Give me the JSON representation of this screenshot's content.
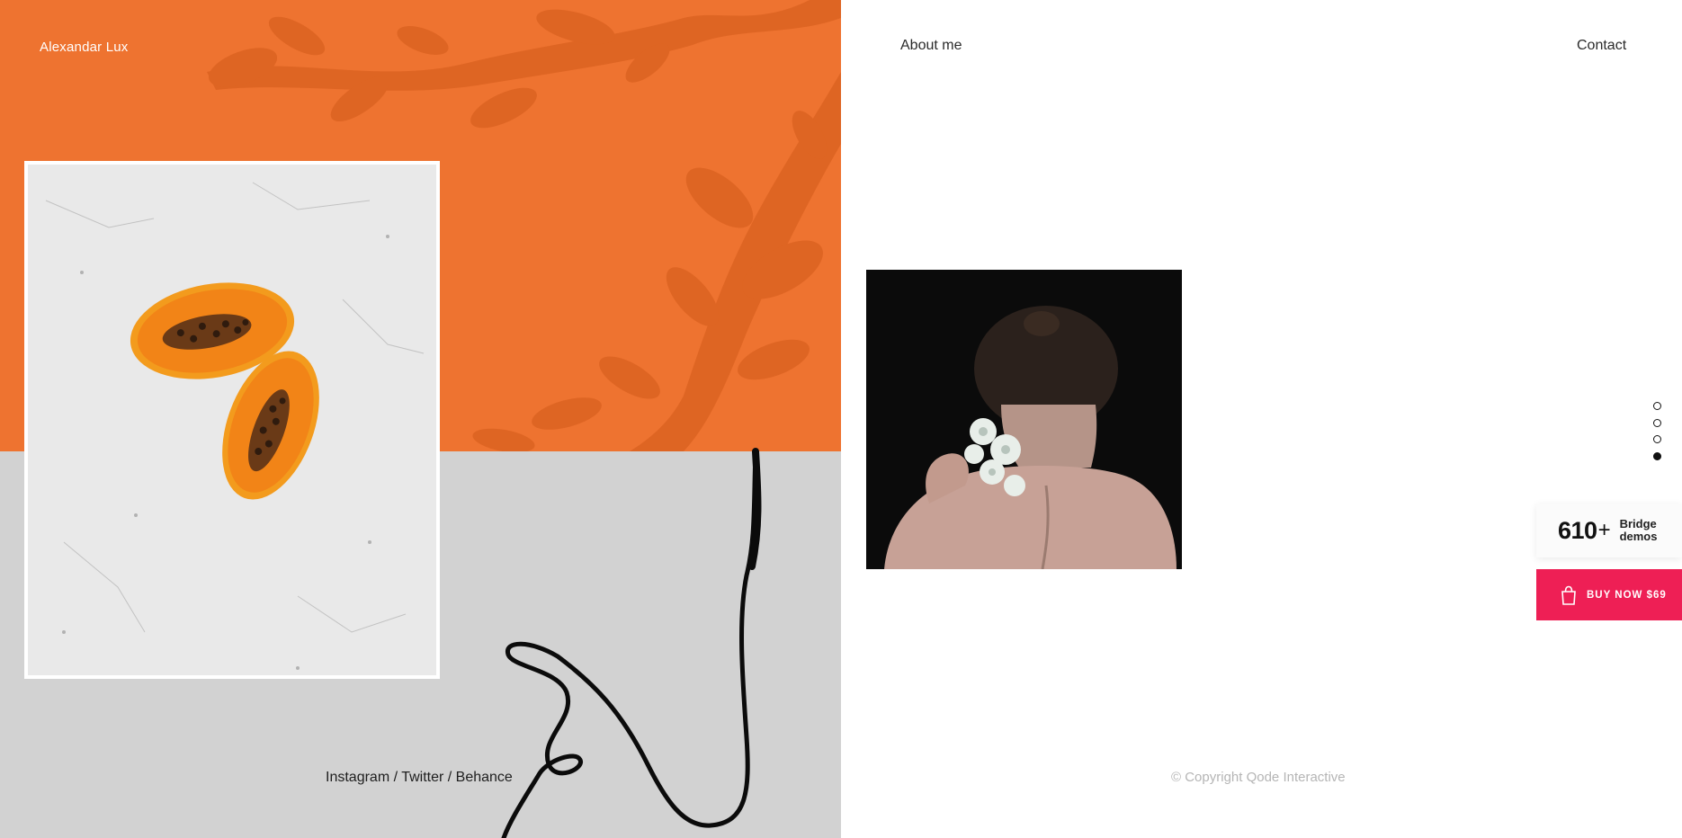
{
  "header": {
    "brand": "Alexandar Lux",
    "nav_about": "About me",
    "nav_contact": "Contact"
  },
  "footer": {
    "social": "Instagram / Twitter / Behance",
    "copyright": "© Copyright Qode Interactive"
  },
  "slider": {
    "dots": 4,
    "active_index": 3
  },
  "demos_badge": {
    "count": "610",
    "plus": "+",
    "label_line1": "Bridge",
    "label_line2": "demos"
  },
  "buy_button": {
    "label": "BUY NOW $69",
    "icon": "shopping-bag-icon"
  },
  "colors": {
    "orange": "#ee7330",
    "grey": "#d2d2d2",
    "buy_accent": "#ee1f55"
  }
}
